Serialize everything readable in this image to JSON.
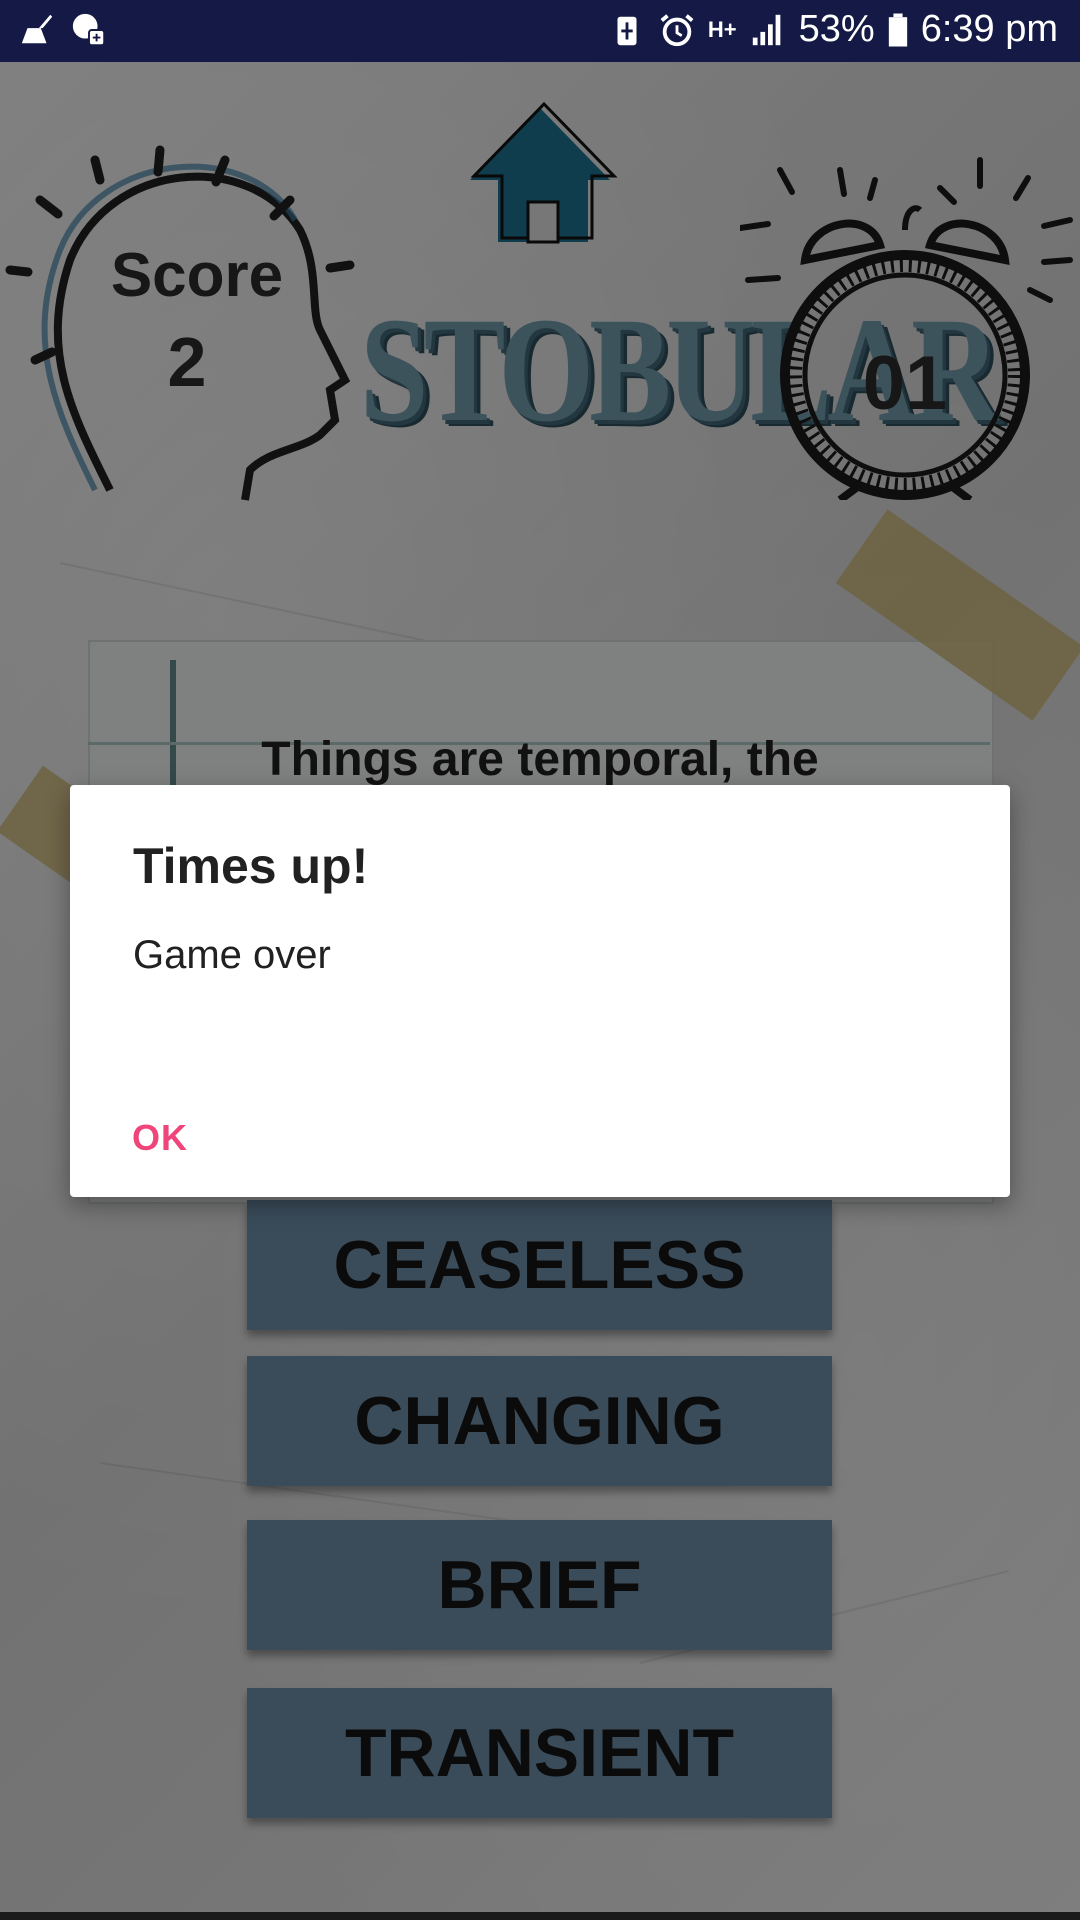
{
  "status_bar": {
    "battery": "53%",
    "time": "6:39 pm",
    "network": "H+",
    "icons": [
      "cleaner-icon",
      "game-icon",
      "battery-saver-icon",
      "alarm-icon",
      "network-icon",
      "signal-icon",
      "battery-icon"
    ]
  },
  "game": {
    "score_label": "Score",
    "score_value": "2",
    "logo_text": "STOBULAR",
    "timer_value": "01",
    "question": "Things are temporal, the",
    "answers": [
      "CEASELESS",
      "CHANGING",
      "BRIEF",
      "TRANSIENT"
    ],
    "colors": {
      "answer_bg": "#6a8aa4",
      "home": "#1e6f8c",
      "logo": "#6f98a8"
    }
  },
  "dialog": {
    "title": "Times up!",
    "message": "Game over",
    "ok_label": "OK",
    "accent": "#f0457a"
  }
}
